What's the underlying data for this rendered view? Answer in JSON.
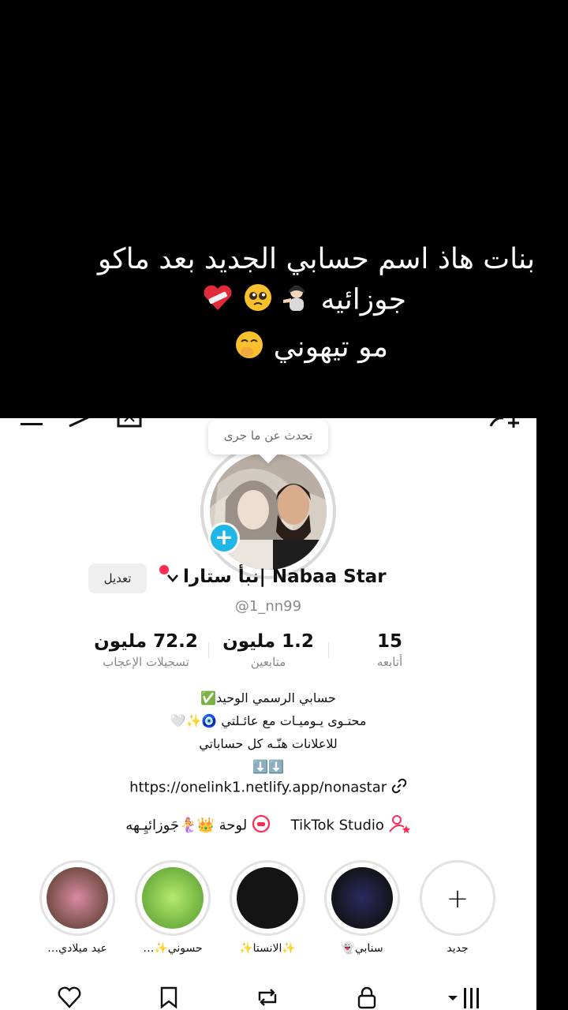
{
  "caption": {
    "line1": "بنات هاذ اسم حسابي الجديد بعد ماكو",
    "line2": "جوزائيه",
    "line3": "مو تيهوني"
  },
  "profile": {
    "bubble_text": "تحدث عن ما جرى",
    "display_name": "نبأ ستارا| Nabaa Star",
    "edit_label": "تعديل",
    "handle": "@1_nn99",
    "stats": [
      {
        "value": "15",
        "label": "أتابعه"
      },
      {
        "value": "1.2 مليون",
        "label": "متابعين"
      },
      {
        "value": "72.2 مليون",
        "label": "تسجيلات الإعجاب"
      }
    ],
    "bio_lines": [
      "حسابي الرسمي الوحيد✅",
      "محتـوى يـوميـات مع عائـلتي 🧿✨🤍",
      "للاعلانات هنّـه كل حساباتي",
      "⬇️⬇️"
    ],
    "link": "https://onelink1.netlify.app/nonastar",
    "chips": [
      {
        "label": "TikTok Studio",
        "icon": "person-star-icon"
      },
      {
        "label": "لوحة 👑🧜‍♀️جَوزائيِـهه",
        "icon": "chat-bubble-icon"
      }
    ]
  },
  "highlights": [
    {
      "label": "جديد",
      "kind": "add"
    },
    {
      "label": "سنابي👻",
      "kind": "image",
      "color": "#1a1a2e"
    },
    {
      "label": "✨الانستا✨",
      "kind": "image",
      "color": "#111111"
    },
    {
      "label": "حسوني✨…",
      "kind": "image",
      "color": "#7fc44a"
    },
    {
      "label": "عيد ميلادي…",
      "kind": "image",
      "color": "#6b4e3d"
    }
  ],
  "tabs": [
    "heart-icon",
    "bookmark-icon",
    "repost-icon",
    "lock-icon",
    "grid-icon"
  ],
  "colors": {
    "accent": "#fe2c55",
    "add_badge": "#20b6e8"
  }
}
